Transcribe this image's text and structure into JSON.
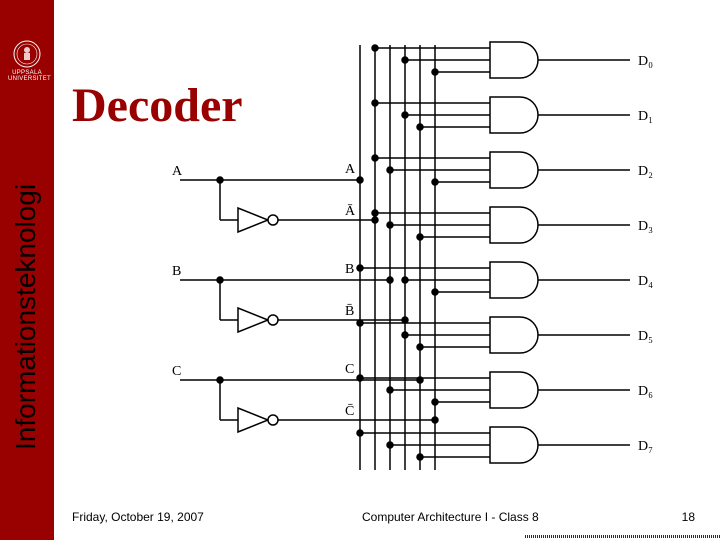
{
  "brand": {
    "name": "UPPSALA UNIVERSITET"
  },
  "title": "Decoder",
  "side_label": "Informationsteknologi",
  "diagram": {
    "inputs": [
      {
        "name": "A",
        "bar": "Ā"
      },
      {
        "name": "B",
        "bar": "B̄"
      },
      {
        "name": "C",
        "bar": "C̄"
      }
    ],
    "outputs": [
      "D₀",
      "D₁",
      "D₂",
      "D₃",
      "D₄",
      "D₅",
      "D₆",
      "D₇"
    ]
  },
  "footer": {
    "date": "Friday, October 19, 2007",
    "course": "Computer Architecture I - Class 8",
    "page": "18"
  }
}
